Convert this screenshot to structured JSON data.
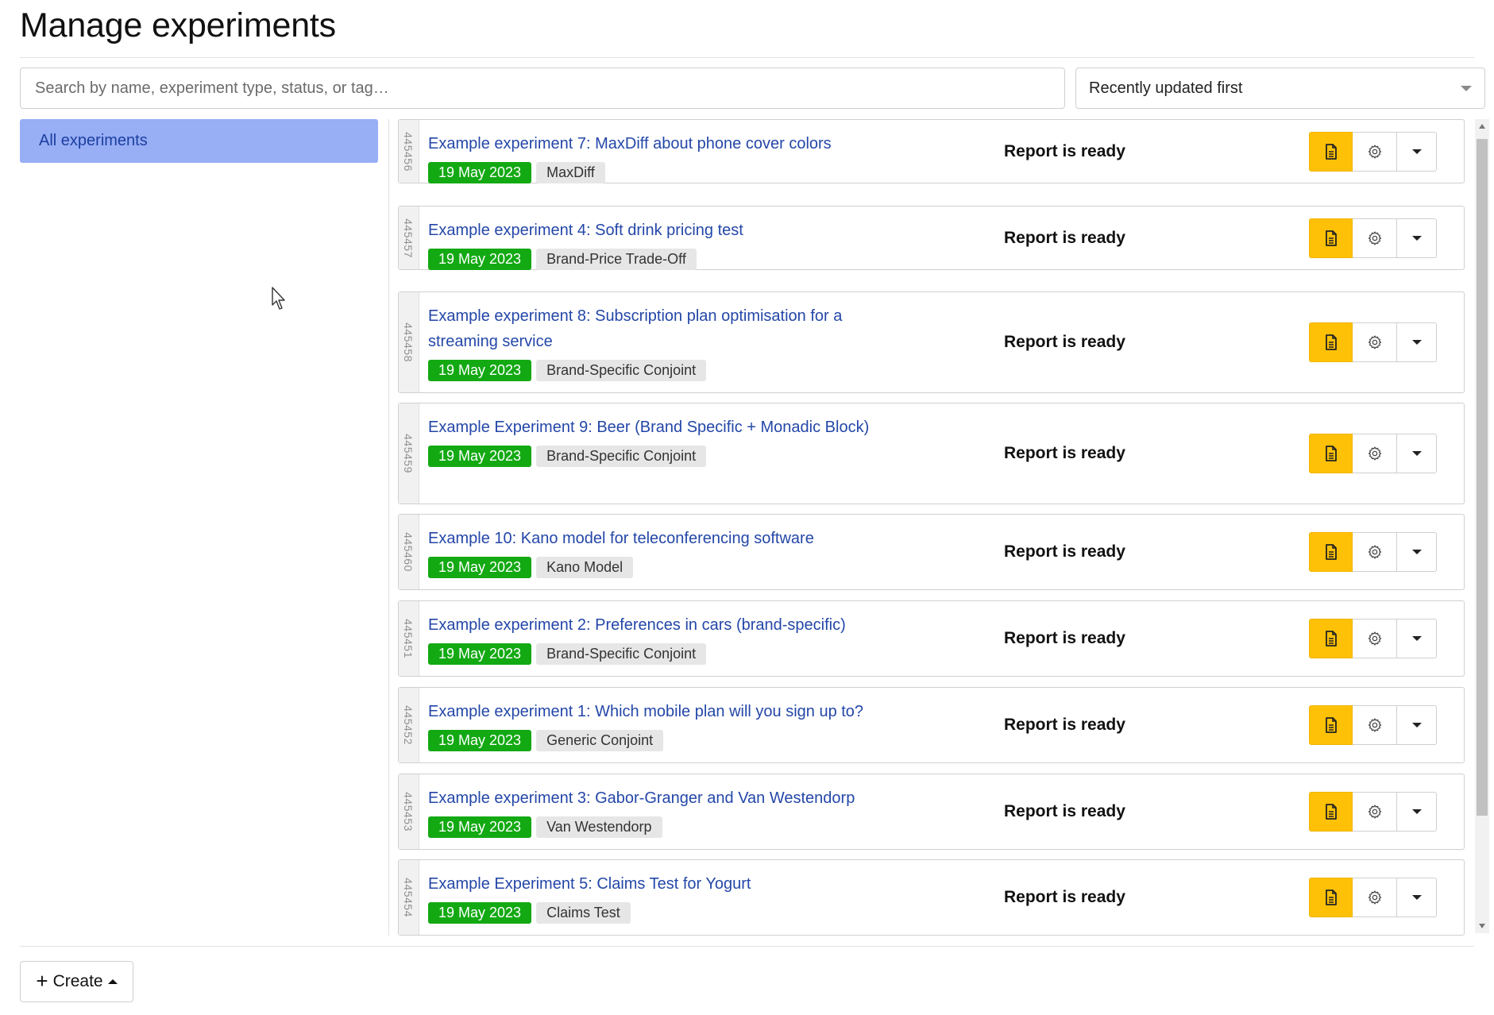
{
  "page": {
    "title": "Manage experiments"
  },
  "search": {
    "placeholder": "Search by name, experiment type, status, or tag…"
  },
  "sort": {
    "selected": "Recently updated first"
  },
  "sidebar": {
    "items": [
      {
        "label": "All experiments",
        "active": true
      }
    ]
  },
  "experiments": [
    {
      "id": "445456",
      "name": "Example experiment 7: MaxDiff about phone cover colors",
      "date": "19 May 2023",
      "type": "MaxDiff",
      "status": "Report is ready"
    },
    {
      "id": "445457",
      "name": "Example experiment 4: Soft drink pricing test",
      "date": "19 May 2023",
      "type": "Brand-Price Trade-Off",
      "status": "Report is ready"
    },
    {
      "id": "445458",
      "name": "Example experiment 8: Subscription plan optimisation for a streaming service",
      "date": "19 May 2023",
      "type": "Brand-Specific Conjoint",
      "status": "Report is ready"
    },
    {
      "id": "445459",
      "name": "Example Experiment 9: Beer (Brand Specific + Monadic Block)",
      "date": "19 May 2023",
      "type": "Brand-Specific Conjoint",
      "status": "Report is ready"
    },
    {
      "id": "445460",
      "name": "Example 10: Kano model for teleconferencing software",
      "date": "19 May 2023",
      "type": "Kano Model",
      "status": "Report is ready"
    },
    {
      "id": "445451",
      "name": "Example experiment 2: Preferences in cars (brand-specific)",
      "date": "19 May 2023",
      "type": "Brand-Specific Conjoint",
      "status": "Report is ready"
    },
    {
      "id": "445452",
      "name": "Example experiment 1: Which mobile plan will you sign up to?",
      "date": "19 May 2023",
      "type": "Generic Conjoint",
      "status": "Report is ready"
    },
    {
      "id": "445453",
      "name": "Example experiment 3: Gabor-Granger and Van Westendorp",
      "date": "19 May 2023",
      "type": "Van Westendorp",
      "status": "Report is ready"
    },
    {
      "id": "445454",
      "name": "Example Experiment 5: Claims Test for Yogurt",
      "date": "19 May 2023",
      "type": "Claims Test",
      "status": "Report is ready"
    }
  ],
  "footer": {
    "create_label": "Create"
  },
  "colors": {
    "sidebar_active": "#98aef5",
    "link": "#2447a8",
    "date_tag": "#13a913",
    "report_button": "#ffc107"
  },
  "icons": {
    "report": "document-icon",
    "settings": "gear-icon",
    "more": "caret-down-icon",
    "create": "plus-icon"
  }
}
